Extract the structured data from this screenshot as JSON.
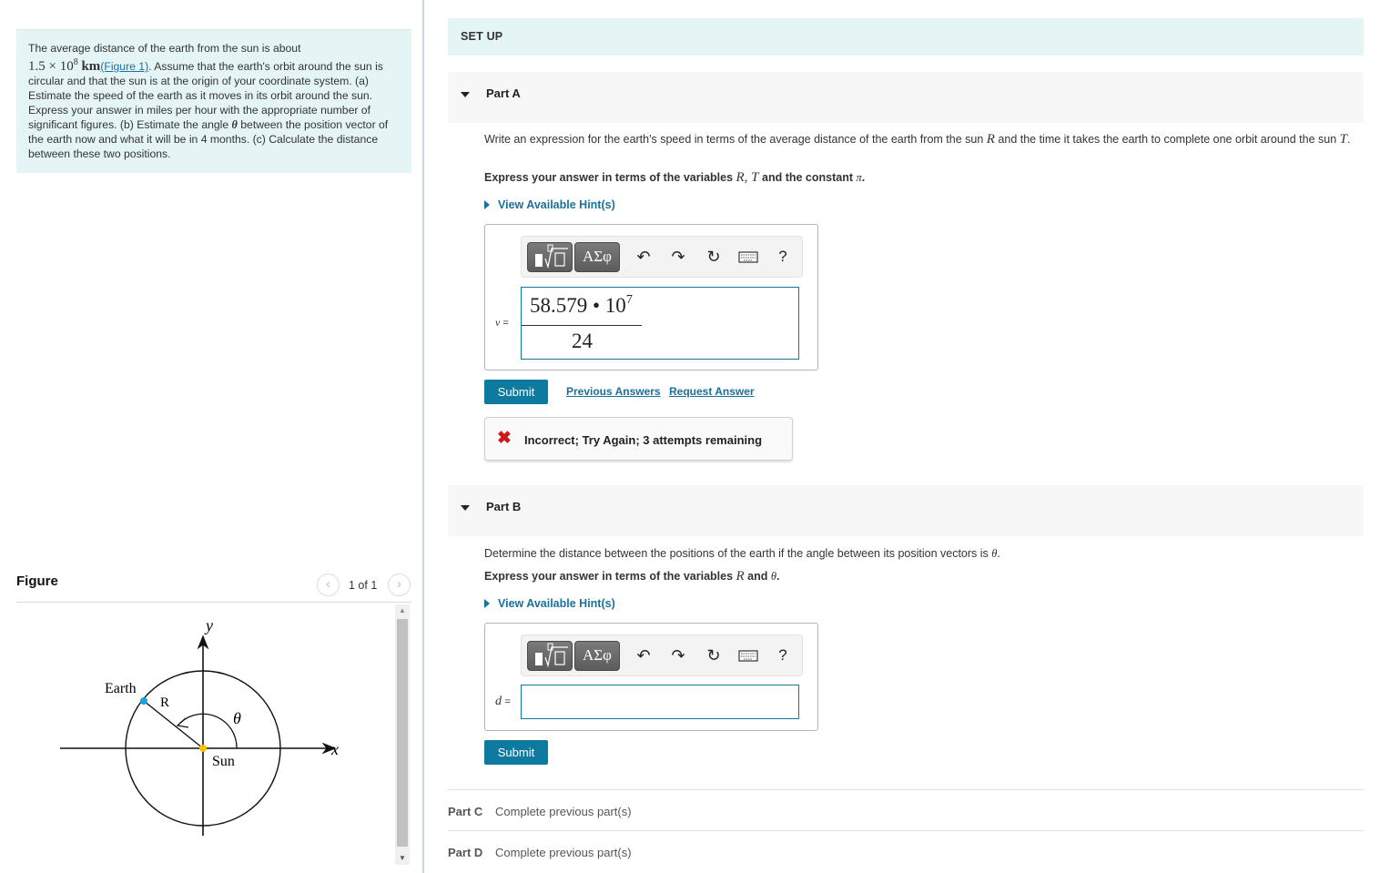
{
  "problem": {
    "text_before": "The average distance of the earth from the sun is about",
    "distance_value": "1.5 × 10",
    "distance_exp": "8",
    "distance_unit": " km",
    "figure_link": "(Figure 1)",
    "text_after": ". Assume that the earth's orbit around the sun is circular and that the sun is at the origin of your coordinate system. (a) Estimate the speed of the earth as it moves in its orbit around the sun. Express your answer in miles per hour with the appropriate number of significant figures. (b) Estimate the angle ",
    "theta": "θ",
    "text_end": " between the position vector of the earth now and what it will be in 4 months. (c) Calculate the distance between these two positions."
  },
  "figure": {
    "title": "Figure",
    "pager": "1 of 1",
    "prev_icon": "chevron-left-icon",
    "next_icon": "chevron-right-icon",
    "labels": {
      "y_axis": "y",
      "x_axis": "x",
      "earth": "Earth",
      "radius": "R",
      "angle": "θ",
      "sun": "Sun"
    },
    "colors": {
      "earth": "#1ba0e2",
      "sun": "#f5c000"
    }
  },
  "setup": {
    "title": "SET UP"
  },
  "partA": {
    "label": "Part A",
    "question_1": "Write an expression for the earth's speed in terms of the average distance of the earth from the sun ",
    "var_R": "R",
    "question_2": " and the time it takes the earth to complete one orbit around the sun ",
    "var_T": "T",
    "question_3": ".",
    "instruction_1": "Express your answer in terms of the variables ",
    "instruction_vars": "R, T",
    "instruction_2": " and the constant ",
    "instruction_pi": "π",
    "instruction_3": ".",
    "hint": "View Available Hint(s)",
    "variable": "v",
    "answer": {
      "numerator": "58.579 • 10",
      "exponent": "7",
      "denominator": "24"
    },
    "submit": "Submit",
    "previous_answers": "Previous Answers",
    "request_answer": "Request Answer",
    "feedback": "Incorrect; Try Again; 3 attempts remaining"
  },
  "toolbar": {
    "templates_icon": "fraction-root-template-icon",
    "greek": "ΑΣφ",
    "undo_icon": "undo-icon",
    "redo_icon": "redo-icon",
    "reset_icon": "reset-icon",
    "keyboard_icon": "keyboard-icon",
    "help": "?"
  },
  "partB": {
    "label": "Part B",
    "question_1": "Determine the distance between the positions of the earth if the angle between its position vectors is ",
    "var_theta": "θ",
    "question_2": ".",
    "instruction_1": "Express your answer in terms of the variables ",
    "var_R": "R",
    "instruction_2": " and ",
    "instruction_theta": "θ",
    "instruction_3": ".",
    "hint": "View Available Hint(s)",
    "variable": "d",
    "answer": "",
    "submit": "Submit"
  },
  "partC": {
    "label": "Part C",
    "status": "Complete previous part(s)"
  },
  "partD": {
    "label": "Part D",
    "status": "Complete previous part(s)"
  }
}
